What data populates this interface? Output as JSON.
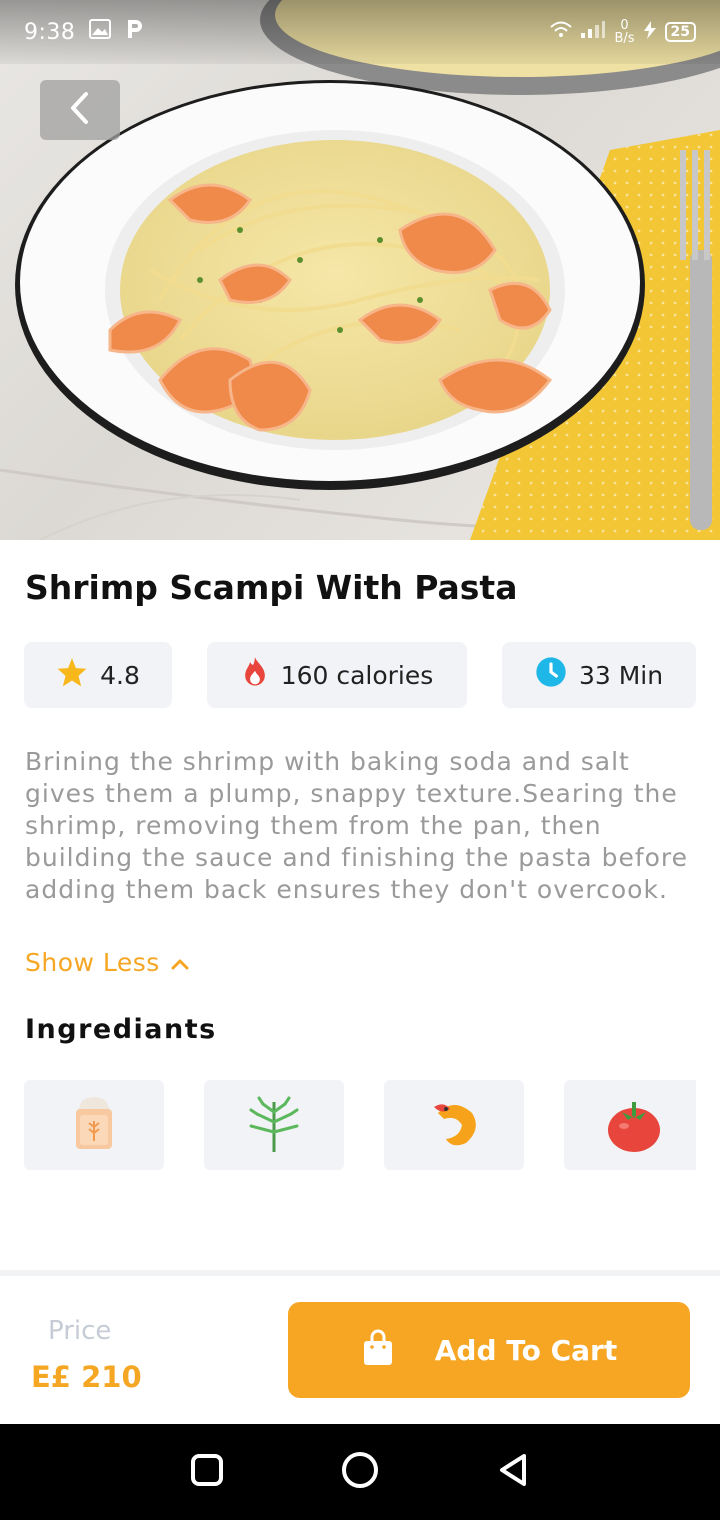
{
  "status_bar": {
    "time": "9:38",
    "net_speed_value": "0",
    "net_speed_unit": "B/s",
    "battery": "25"
  },
  "product": {
    "title": "Shrimp Scampi With Pasta",
    "rating": "4.8",
    "calories": "160 calories",
    "time": "33 Min",
    "description": "Brining the shrimp with baking soda and salt gives them a plump, snappy texture.Searing the shrimp, removing them from the pan, then building the sauce and finishing the pasta before adding them back ensures they don't overcook.",
    "show_less_label": "Show Less"
  },
  "ingredients": {
    "title": "Ingrediants",
    "items": [
      {
        "icon": "flour-icon"
      },
      {
        "icon": "herb-icon"
      },
      {
        "icon": "shrimp-icon"
      },
      {
        "icon": "tomato-icon"
      }
    ]
  },
  "checkout": {
    "price_label": "Price",
    "price_value": "E£ 210",
    "add_to_cart_label": "Add To Cart"
  },
  "colors": {
    "accent": "#f5a623",
    "chip_bg": "#f1f3f6",
    "time_icon": "#1fb6e8",
    "fire_icon": "#e8463c"
  }
}
